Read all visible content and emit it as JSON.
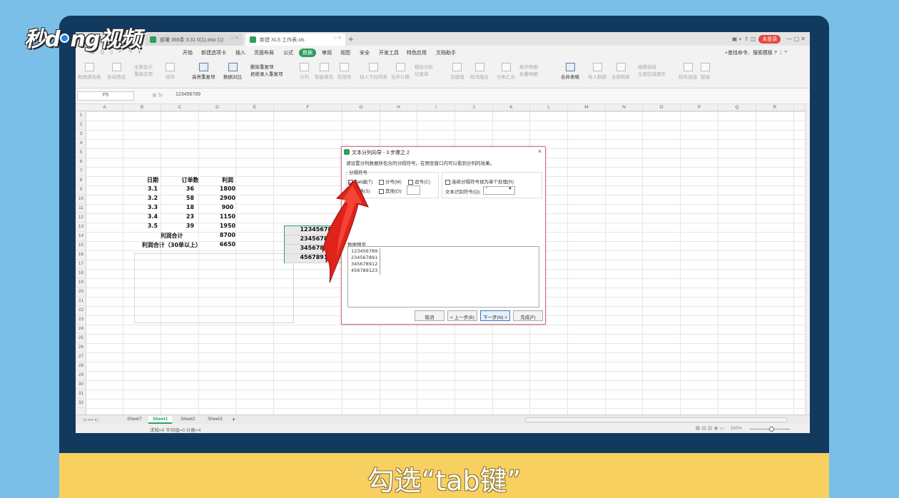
{
  "logo": {
    "part1": "秒d",
    "part2": "ng视频"
  },
  "caption": "勾选“tab键”",
  "tabs": [
    {
      "label": "部署 366条 3.31 0(1).xlsx  (1)"
    },
    {
      "label": "新建 XLS 工作表.xls"
    }
  ],
  "title_buttons": {
    "login": "未登录"
  },
  "menu": [
    "开始",
    "新建选项卡",
    "插入",
    "页面布局",
    "公式",
    "数据",
    "审阅",
    "视图",
    "安全",
    "开发工具",
    "特色应用",
    "文档助手"
  ],
  "search_command": "查找命令、搜索模板",
  "ribbon": [
    "数据透视表",
    "自动筛选",
    "全部显示",
    "重新应用",
    "排序",
    "高亮重复项",
    "数据对比",
    "删除重复项",
    "拒绝录入重复项",
    "分列",
    "智能填充",
    "有效性",
    "插入下拉列表",
    "合并计算",
    "模拟分析",
    "记录单",
    "创建组",
    "取消组合",
    "分类汇总",
    "展开明细",
    "折叠明细",
    "合并表格",
    "导入数据",
    "全部刷新",
    "编辑连接",
    "全部区域属性",
    "现有连接",
    "链接"
  ],
  "formula_bar": {
    "name_box": "F5",
    "fx": "fx",
    "content": "123456789"
  },
  "columns": [
    "A",
    "B",
    "C",
    "D",
    "E",
    "F",
    "G",
    "H",
    "I",
    "J",
    "K",
    "L",
    "M",
    "N",
    "O",
    "P",
    "Q",
    "R"
  ],
  "table": {
    "headers": [
      "日期",
      "订单数",
      "利润"
    ],
    "rows": [
      [
        "3.1",
        "36",
        "1800"
      ],
      [
        "3.2",
        "58",
        "2900"
      ],
      [
        "3.3",
        "18",
        "900"
      ],
      [
        "3.4",
        "23",
        "1150"
      ],
      [
        "3.5",
        "39",
        "1950"
      ]
    ],
    "total_label": "利润合计",
    "total_value": "8700",
    "total30_label": "利润合计（30单以上）",
    "total30_value": "6650"
  },
  "selection": [
    "123456789",
    "234567891",
    "345678912",
    "456789123"
  ],
  "sheets": [
    "Sheet7",
    "Sheet1",
    "Sheet2",
    "Sheet3"
  ],
  "status": {
    "text": "求和=0  平均值=0  计数=4",
    "zoom": "100%"
  },
  "dialog": {
    "title": "文本分列向导 - 3 步骤之 2",
    "desc": "请设置分列数据所包含的分隔符号。在预览窗口内可以看到分列的效果。",
    "group_label": "分隔符号",
    "tab": "Tab键(T)",
    "semicolon": "分号(M)",
    "comma": "逗号(C)",
    "space": "空格(S)",
    "other": "其他(O):",
    "consecutive": "连续分隔符号视为单个处理(R)",
    "qualifier_label": "文本识别符号(Q):",
    "qualifier_value": "\"",
    "preview_label": "数据预览",
    "preview": [
      "123456789",
      "234567891",
      "345678912",
      "456789123"
    ],
    "buttons": {
      "cancel": "取消",
      "back": "< 上一步(B)",
      "next": "下一步(N) >",
      "finish": "完成(F)"
    }
  }
}
